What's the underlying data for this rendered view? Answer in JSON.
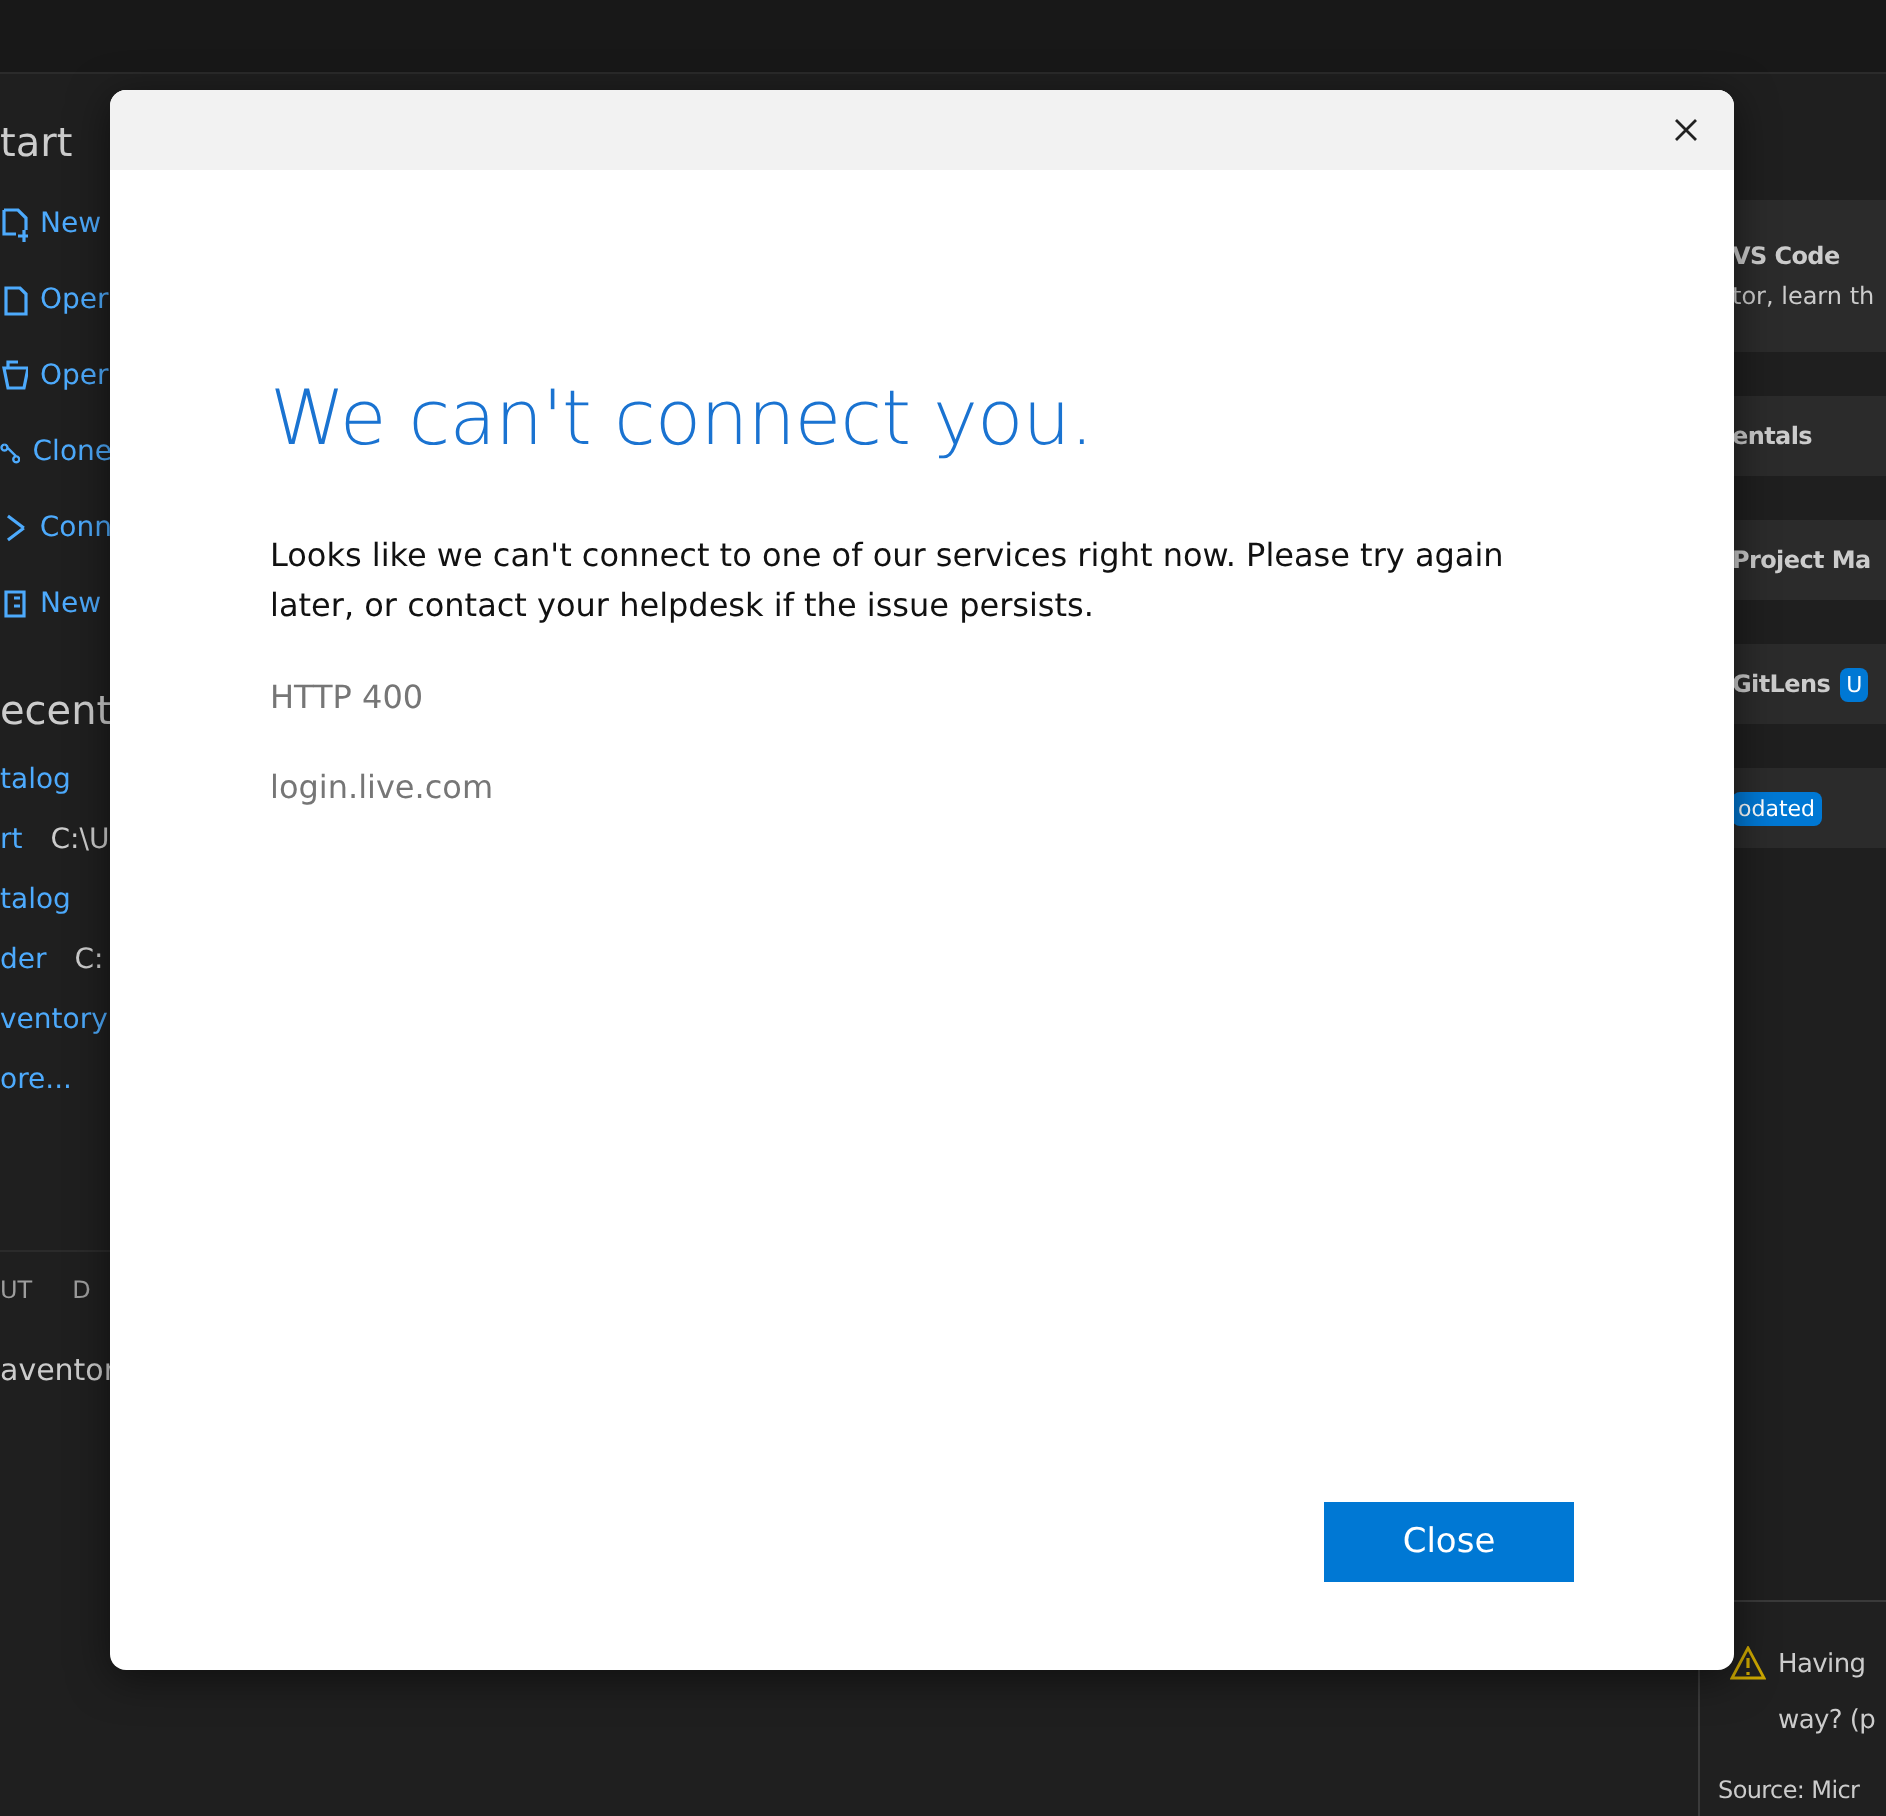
{
  "start": {
    "title": "tart",
    "actions": [
      {
        "kind": "new-file",
        "label": "New"
      },
      {
        "kind": "open-file",
        "label": "Oper"
      },
      {
        "kind": "open-folder",
        "label": "Oper"
      },
      {
        "kind": "clone",
        "label": "Clone"
      },
      {
        "kind": "connect",
        "label": "Conn"
      },
      {
        "kind": "new-notebook",
        "label": "New"
      }
    ]
  },
  "recent": {
    "title": "ecent",
    "items": [
      {
        "name": "talog"
      },
      {
        "name": "rt",
        "path": "C:\\U"
      },
      {
        "name": "talog"
      },
      {
        "name": "der",
        "path": "C:"
      },
      {
        "name": "ventory"
      },
      {
        "name": "ore..."
      }
    ]
  },
  "panel": {
    "tabs": [
      {
        "label": "UT"
      },
      {
        "label": "D"
      }
    ],
    "line": "aventor"
  },
  "walkthroughs": [
    {
      "title": "VS Code",
      "description": "tor, learn th"
    },
    {
      "title": "entals"
    },
    {
      "title": "Project Ma"
    },
    {
      "title": "GitLens",
      "badge": "U"
    },
    {
      "badge": "odated"
    }
  ],
  "notification": {
    "message_lines": [
      "Having",
      "way? (p"
    ],
    "source": "Source: Micr"
  },
  "dialog": {
    "heading": "We can't connect you.",
    "message": "Looks like we can't connect to one of our services right now. Please try again later, or contact your helpdesk if the issue persists.",
    "error_code": "HTTP 400",
    "host": "login.live.com",
    "button": "Close"
  }
}
